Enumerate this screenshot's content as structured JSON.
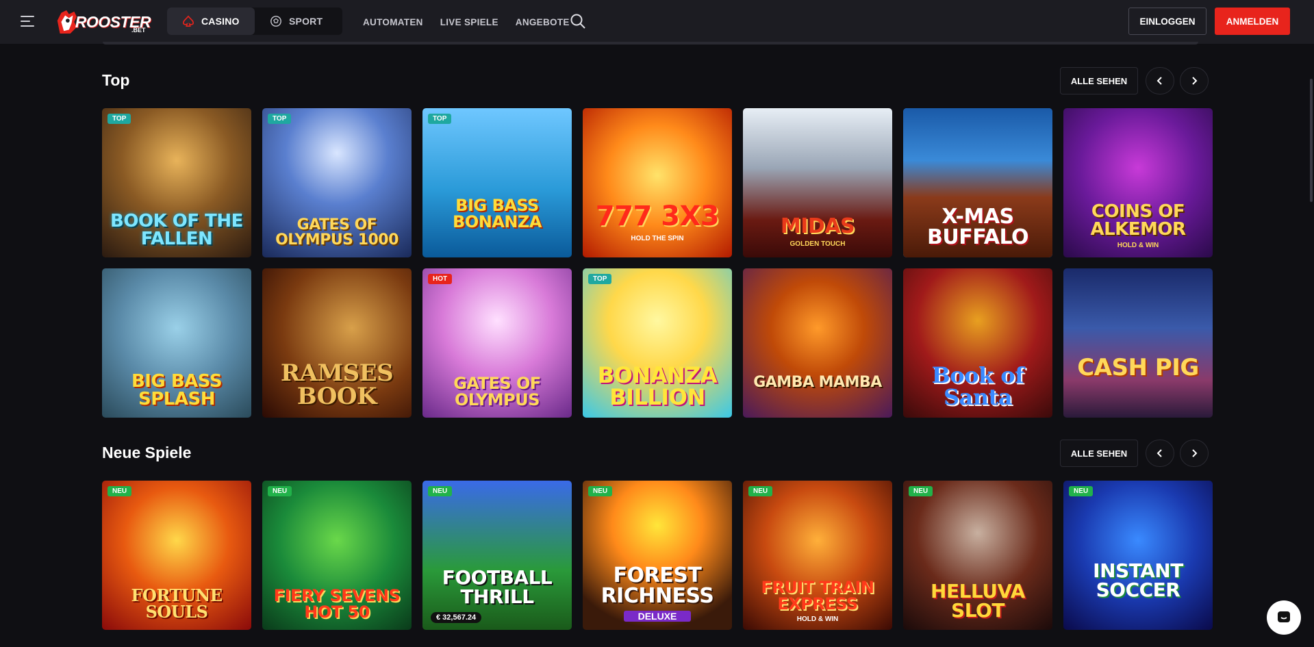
{
  "header": {
    "logo_text": "ROOSTER",
    "logo_sub": ".BET",
    "segments": [
      {
        "label": "CASINO",
        "icon": "spade-icon"
      },
      {
        "label": "SPORT",
        "icon": "soccer-ball-icon"
      }
    ],
    "nav": [
      "AUTOMATEN",
      "LIVE SPIELE",
      "ANGEBOTE"
    ],
    "login_label": "EINLOGGEN",
    "register_label": "ANMELDEN"
  },
  "colors": {
    "accent": "#e8241c",
    "background": "#0f0f13",
    "header": "#1c1c22",
    "selected_outline": "#2d7be0"
  },
  "sections": [
    {
      "title": "Top",
      "see_all_label": "ALLE SEHEN",
      "games": [
        {
          "title": "BOOK OF THE FALLEN",
          "badge": "TOP"
        },
        {
          "title": "GATES OF OLYMPUS 1000",
          "badge": "TOP"
        },
        {
          "title": "BIG BASS BONANZA",
          "badge": "TOP"
        },
        {
          "title": "777 3X3",
          "sub": "HOLD THE SPIN",
          "badge": ""
        },
        {
          "title": "MIDAS",
          "sub": "GOLDEN TOUCH",
          "badge": ""
        },
        {
          "title": "X-MAS BUFFALO",
          "badge": ""
        },
        {
          "title": "COINS OF ALKEMOR",
          "sub": "HOLD & WIN",
          "badge": ""
        },
        {
          "title": "BIG BASS SPLASH",
          "badge": ""
        },
        {
          "title": "RAMSES BOOK",
          "badge": ""
        },
        {
          "title": "GATES OF OLYMPUS",
          "badge": "HOT"
        },
        {
          "title": "BONANZA BILLION",
          "badge": "TOP"
        },
        {
          "title": "GAMBA MAMBA",
          "badge": ""
        },
        {
          "title": "Book of Santa",
          "badge": ""
        },
        {
          "title": "CASH PIG",
          "badge": ""
        }
      ]
    },
    {
      "title": "Neue Spiele",
      "see_all_label": "ALLE SEHEN",
      "games": [
        {
          "title": "FORTUNE SOULS",
          "badge": "NEU"
        },
        {
          "title": "FIERY SEVENS HOT 50",
          "badge": "NEU"
        },
        {
          "title": "FOOTBALL THRILL",
          "badge": "NEU",
          "jackpot": "€ 32,567.24"
        },
        {
          "title": "FOREST RICHNESS",
          "sub": "DELUXE",
          "badge": "NEU"
        },
        {
          "title": "FRUIT TRAIN EXPRESS",
          "sub": "HOLD & WIN",
          "badge": "NEU"
        },
        {
          "title": "HELLUVA SLOT",
          "badge": "NEU"
        },
        {
          "title": "INSTANT SOCCER",
          "badge": "NEU"
        }
      ]
    }
  ]
}
